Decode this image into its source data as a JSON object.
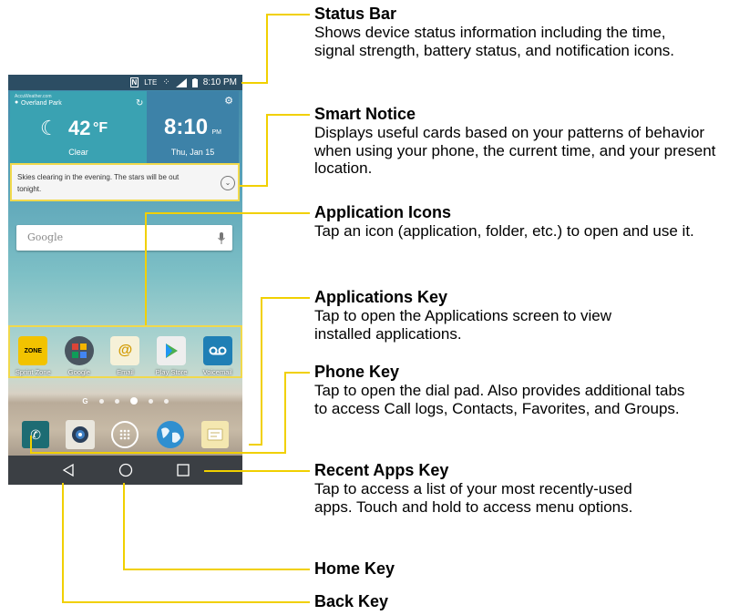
{
  "phone": {
    "status_bar": {
      "nfc": "N",
      "network": "LTE",
      "time": "8:10 PM"
    },
    "weather": {
      "source": "AccuWeather.com",
      "location": "Overland Park",
      "temperature": "42",
      "unit": "°F",
      "condition": "Clear"
    },
    "clock": {
      "time": "8:10",
      "ampm": "PM",
      "date": "Thu, Jan 15"
    },
    "smart_notice": {
      "text": "Skies clearing in the evening. The stars will be out tonight."
    },
    "search": {
      "brand": "Google"
    },
    "apps": [
      {
        "label": "Sprint Zone",
        "icon": "sprint-zone-icon",
        "color": "#f2c300"
      },
      {
        "label": "Google",
        "icon": "google-folder-icon",
        "color": "#4a5560"
      },
      {
        "label": "Email",
        "icon": "email-icon",
        "color": "#f6f1d8"
      },
      {
        "label": "Play Store",
        "icon": "play-store-icon",
        "color": "#eeeeee"
      },
      {
        "label": "Voicemail",
        "icon": "voicemail-icon",
        "color": "#1f7fb5"
      }
    ],
    "page_indicator": {
      "first": "G",
      "pages": 6,
      "active": 3
    },
    "dock": [
      {
        "icon": "phone-icon",
        "color": "#1d6c73"
      },
      {
        "icon": "camera-icon",
        "color": "#e9e6dd"
      },
      {
        "icon": "apps-key-icon",
        "color": "#ffffff"
      },
      {
        "icon": "browser-globe-icon",
        "color": "#2f8fd0"
      },
      {
        "icon": "messaging-icon",
        "color": "#f4e7b0"
      }
    ],
    "nav": [
      {
        "icon": "back-icon"
      },
      {
        "icon": "home-icon"
      },
      {
        "icon": "recent-apps-icon"
      }
    ]
  },
  "callouts": {
    "status_bar": {
      "title": "Status Bar",
      "desc": "Shows device status information including the time, signal strength, battery status, and notification icons."
    },
    "smart_notice": {
      "title": "Smart Notice",
      "desc": "Displays useful cards based on your patterns of behavior when using your phone, the current time, and your present location."
    },
    "application_icons": {
      "title": "Application Icons",
      "desc": "Tap an icon (application, folder, etc.) to open and use it."
    },
    "applications_key": {
      "title": "Applications Key",
      "desc": "Tap to open the Applications screen to view installed applications."
    },
    "phone_key": {
      "title": "Phone Key",
      "desc": "Tap to open the dial pad. Also provides additional tabs to access Call logs, Contacts, Favorites, and Groups."
    },
    "recent_apps_key": {
      "title": "Recent Apps Key",
      "desc": "Tap to access a list of your most recently-used apps. Touch and hold to access menu options."
    },
    "home_key": {
      "title": "Home Key"
    },
    "back_key": {
      "title": "Back Key"
    }
  },
  "colors": {
    "leader": "#f1d000",
    "highlight": "#f1d94c"
  }
}
